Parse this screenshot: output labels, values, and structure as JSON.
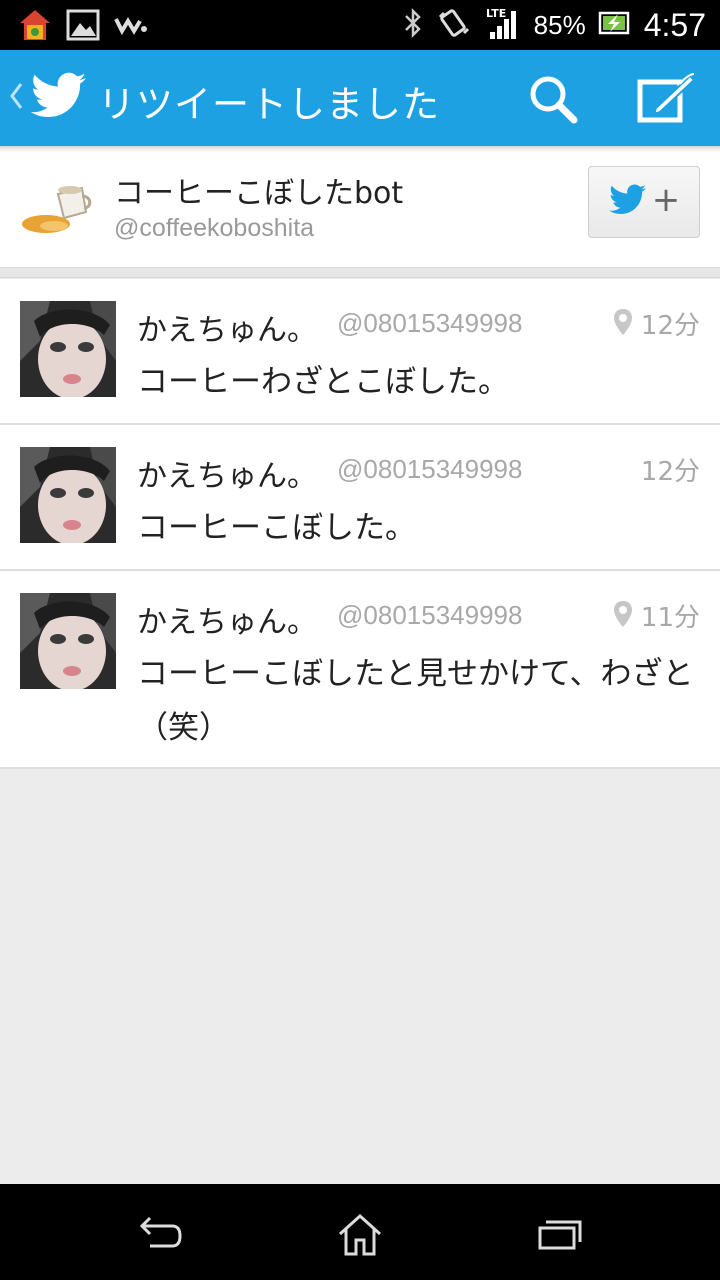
{
  "status_bar": {
    "battery_percent": "85%",
    "time": "4:57",
    "network": "LTE"
  },
  "action_bar": {
    "title": "リツイートしました"
  },
  "profile": {
    "name": "コーヒーこぼしたbot",
    "handle": "@coffeekoboshita"
  },
  "tweets": [
    {
      "name": "かえちゅん。",
      "handle": "@08015349998",
      "time": "12分",
      "has_location": true,
      "text": "コーヒーわざとこぼした。"
    },
    {
      "name": "かえちゅん。",
      "handle": "@08015349998",
      "time": "12分",
      "has_location": false,
      "text": "コーヒーこぼした。"
    },
    {
      "name": "かえちゅん。",
      "handle": "@08015349998",
      "time": "11分",
      "has_location": true,
      "text": "コーヒーこぼしたと見せかけて、わざと（笑）"
    }
  ],
  "icons": {
    "status_left": [
      "launcher-icon",
      "gallery-icon",
      "walkman-icon"
    ],
    "status_right": [
      "bluetooth-icon",
      "vibrate-icon",
      "signal-icon",
      "battery-icon"
    ],
    "action_bar": [
      "back-chevron-icon",
      "twitter-bird-icon",
      "search-icon",
      "compose-icon"
    ],
    "nav": [
      "back-icon",
      "home-icon",
      "recents-icon"
    ]
  },
  "colors": {
    "accent": "#1da1e2",
    "background": "#ececec"
  }
}
